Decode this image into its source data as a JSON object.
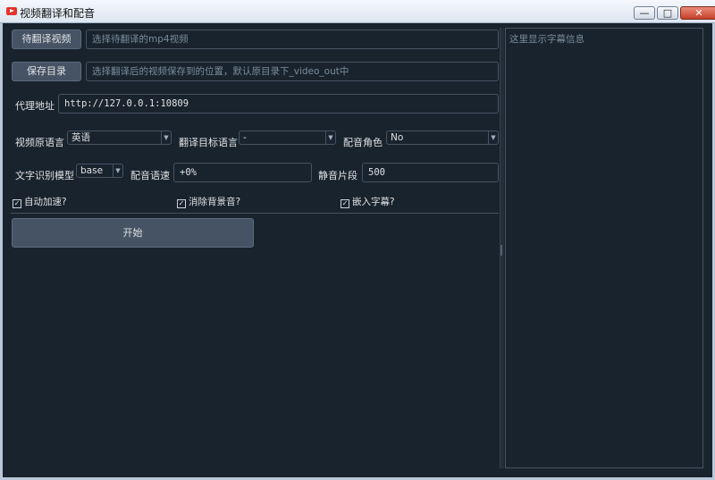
{
  "window": {
    "title": "视频翻译和配音",
    "minimize_glyph": "—",
    "maximize_glyph": "□",
    "close_glyph": "✕"
  },
  "source_video": {
    "button_label": "待翻译视频",
    "placeholder": "选择待翻译的mp4视频"
  },
  "save_dir": {
    "button_label": "保存目录",
    "placeholder": "选择翻译后的视频保存到的位置，默认原目录下_video_out中"
  },
  "proxy": {
    "label": "代理地址",
    "value": "http://127.0.0.1:10809"
  },
  "source_lang": {
    "label": "视频原语言",
    "selected": "英语"
  },
  "target_lang": {
    "label": "翻译目标语言",
    "selected": "-"
  },
  "voice_role": {
    "label": "配音角色",
    "selected": "No"
  },
  "whisper_model": {
    "label": "文字识别模型",
    "selected": "base"
  },
  "voice_rate": {
    "label": "配音语速",
    "value": "+0%"
  },
  "silence": {
    "label": "静音片段",
    "value": "500"
  },
  "options": {
    "auto_speed": "自动加速?",
    "remove_bg": "消除背景音?",
    "embed_sub": "嵌入字幕?",
    "check_glyph": "✓"
  },
  "start_button": "开始",
  "subtitle_panel": {
    "placeholder": "这里显示字幕信息"
  },
  "colors": {
    "background": "#19232d",
    "button": "#455364",
    "border": "#455364",
    "text": "#e0e1e3"
  }
}
